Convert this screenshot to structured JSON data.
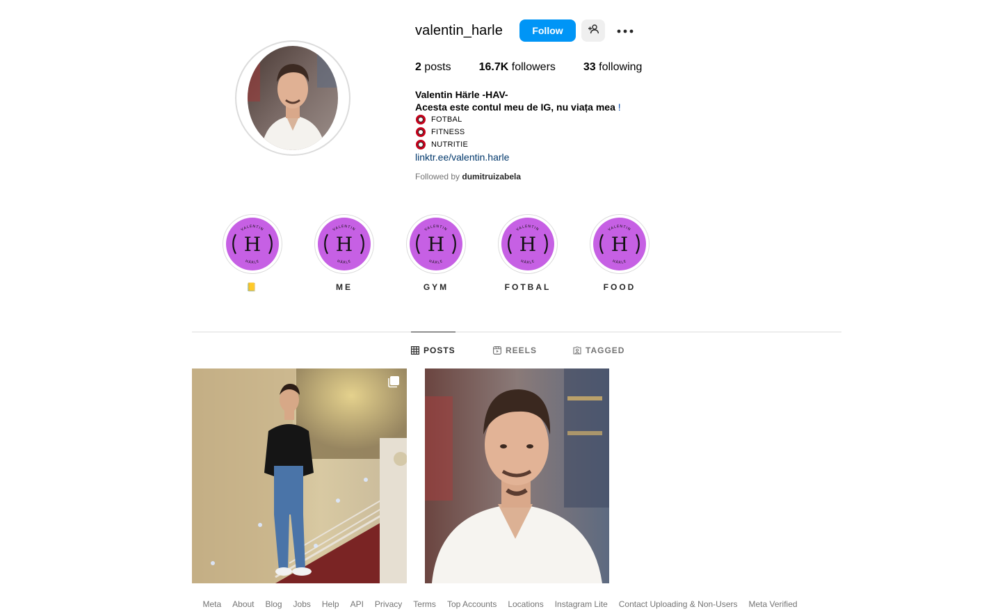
{
  "profile": {
    "username": "valentin_harle",
    "follow_label": "Follow",
    "suggest_icon": "person-plus-icon",
    "more_icon": "ellipsis-icon",
    "stats": {
      "posts_count": "2",
      "posts_label": "posts",
      "followers_count": "16.7K",
      "followers_label": "followers",
      "following_count": "33",
      "following_label": "following"
    },
    "full_name": "Valentin Härle -HAV-",
    "bio_line": "Acesta este contul meu de IG, nu viața mea",
    "bio_line_end": " !",
    "bio_items": [
      "FOTBAL",
      "FITNESS",
      "NUTRITIE"
    ],
    "link": "linktr.ee/valentin.harle",
    "followed_by_prefix": "Followed by",
    "followed_by_user": "dumitruizabela"
  },
  "highlights": [
    {
      "label": "📒",
      "monogram": "H",
      "ring_text_top": "VALENTIN",
      "ring_text_bottom": "HÄRLE"
    },
    {
      "label": "ME",
      "monogram": "H",
      "ring_text_top": "VALENTIN",
      "ring_text_bottom": "HÄRLE"
    },
    {
      "label": "GYM",
      "monogram": "H",
      "ring_text_top": "VALENTIN",
      "ring_text_bottom": "HÄRLE"
    },
    {
      "label": "FOTBAL",
      "monogram": "H",
      "ring_text_top": "VALENTIN",
      "ring_text_bottom": "HÄRLE"
    },
    {
      "label": "FOOD",
      "monogram": "H",
      "ring_text_top": "VALENTIN",
      "ring_text_bottom": "HÄRLE"
    }
  ],
  "tabs": [
    {
      "label": "POSTS",
      "icon": "grid-icon",
      "active": true
    },
    {
      "label": "REELS",
      "icon": "reels-icon",
      "active": false
    },
    {
      "label": "TAGGED",
      "icon": "tagged-icon",
      "active": false
    }
  ],
  "posts": [
    {
      "type": "carousel",
      "icon": "carousel-icon"
    },
    {
      "type": "image"
    }
  ],
  "footer": {
    "links": [
      "Meta",
      "About",
      "Blog",
      "Jobs",
      "Help",
      "API",
      "Privacy",
      "Terms",
      "Top Accounts",
      "Locations",
      "Instagram Lite",
      "Contact Uploading & Non-Users",
      "Meta Verified"
    ]
  },
  "colors": {
    "follow_button": "#0095f6",
    "highlight_fill": "#c660e4",
    "link": "#00376b"
  }
}
